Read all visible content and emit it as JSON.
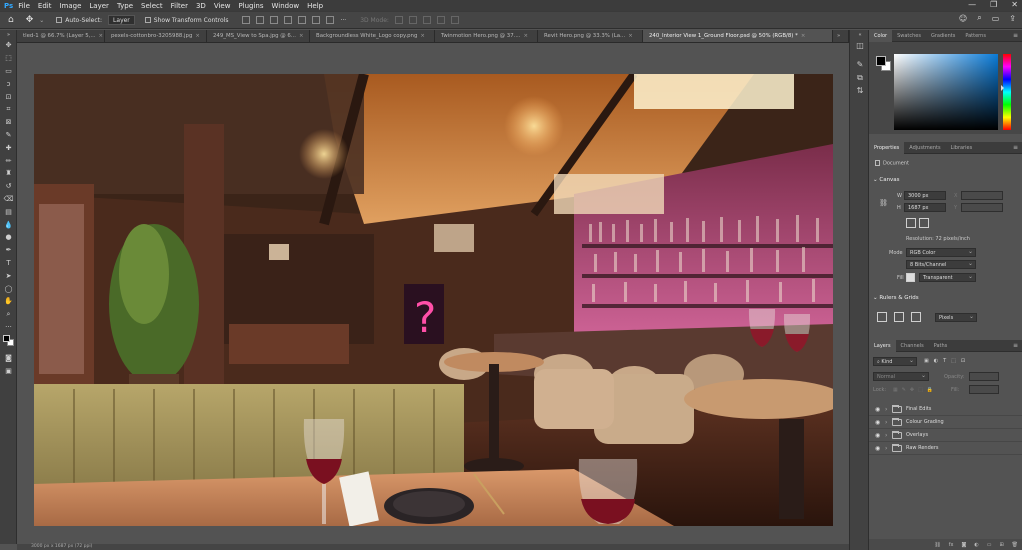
{
  "menu": {
    "logo": "Ps",
    "items": [
      "File",
      "Edit",
      "Image",
      "Layer",
      "Type",
      "Select",
      "Filter",
      "3D",
      "View",
      "Plugins",
      "Window",
      "Help"
    ],
    "window_controls": [
      "—",
      "❐",
      "✕"
    ]
  },
  "options_bar": {
    "auto_select_label": "Auto-Select:",
    "auto_select_value": "Layer",
    "show_transform_label": "Show Transform Controls",
    "mode_3d_label": "3D Mode:"
  },
  "tabs": [
    {
      "label": "tled-1 @ 66.7% (Layer 5,...",
      "active": false
    },
    {
      "label": "pexels-cottonbro-3205988.jpg",
      "active": false
    },
    {
      "label": "249_MS_View to Spa.jpg @ 6...",
      "active": false
    },
    {
      "label": "Backgroundless White_Logo copy.png",
      "active": false
    },
    {
      "label": "Twinmotion Hero.png @ 37....",
      "active": false
    },
    {
      "label": "Revit Hero.png @ 33.3% (La...",
      "active": false
    },
    {
      "label": "240_Interior View 1_Ground Floor.psd @ 50% (RGB/8) *",
      "active": true
    }
  ],
  "tab_overflow": "»",
  "status_bar": "3000 px x 1687 px (72 ppi)",
  "color_panel": {
    "tabs": [
      "Color",
      "Swatches",
      "Gradients",
      "Patterns"
    ],
    "foreground": "#000000",
    "background": "#ffffff"
  },
  "properties_panel": {
    "tabs": [
      "Properties",
      "Adjustments",
      "Libraries"
    ],
    "document_label": "Document",
    "canvas_section": "Canvas",
    "width_label": "W",
    "width_value": "3000 px",
    "x_label": "X",
    "height_label": "H",
    "height_value": "1687 px",
    "y_label": "Y",
    "resolution": "Resolution: 72 pixels/inch",
    "mode_label": "Mode",
    "mode_value": "RGB Color",
    "bits_value": "8 Bits/Channel",
    "fill_label": "Fill",
    "fill_value": "Transparent",
    "rulers_section": "Rulers & Grids",
    "units_value": "Pixels"
  },
  "layers_panel": {
    "tabs": [
      "Layers",
      "Channels",
      "Paths"
    ],
    "kind_label": "Kind",
    "blend_mode": "Normal",
    "opacity_label": "Opacity:",
    "lock_label": "Lock:",
    "fill_label": "Fill:",
    "layers": [
      "Final Edits",
      "Colour Grading",
      "Overlays",
      "Raw Renders"
    ]
  }
}
